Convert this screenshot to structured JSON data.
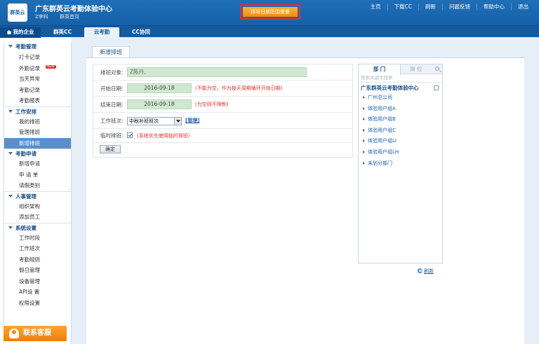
{
  "header": {
    "logo_text": "群英云",
    "title": "广东群英云考勤体验中心",
    "sub_user": "Z李科",
    "sub_link": "群英首页",
    "notice": "排班日期范围重叠",
    "topnav": [
      "主页",
      "下载CC",
      "刷新",
      "问题反馈",
      "帮助中心",
      "退出"
    ]
  },
  "tabs": {
    "my_company": "我的企业",
    "qunying_cc": "群英CC",
    "cloud_attendance": "云考勤",
    "cc_collab": "CC协同"
  },
  "sidebar": {
    "groups": [
      {
        "title": "考勤管理",
        "items": [
          "打卡记录",
          "外勤记录",
          "当天异常",
          "考勤记录",
          "考勤报表"
        ]
      },
      {
        "title": "工作安排",
        "items": [
          "我的排班",
          "管理排班",
          "新增排班"
        ]
      },
      {
        "title": "考勤申请",
        "items": [
          "新增申请",
          "申 请 单",
          "请假类别"
        ]
      },
      {
        "title": "人事管理",
        "items": [
          "组织架构",
          "添加员工"
        ]
      },
      {
        "title": "系统设置",
        "items": [
          "工作时段",
          "工作班次",
          "考勤规则",
          "假日管理",
          "设备管理",
          "API设 置",
          "权限设置"
        ]
      }
    ],
    "new_badge": "NEW",
    "service_button": "联系客服"
  },
  "page": {
    "tab_title": "新增排班",
    "form": {
      "target_label": "排班对象:",
      "target_value": "Z陈丹,",
      "start_label": "开始日期:",
      "start_value": "2016-09-18",
      "start_hint": "(不能为空，作为按天周期循环开始日期)",
      "end_label": "结束日期:",
      "end_value": "2016-09-18",
      "end_hint": "(为空则不限制)",
      "shift_label": "工作班次:",
      "shift_value": "中秋补班班次",
      "manage_link": "[管理]",
      "temp_label": "临时排班:",
      "temp_checked": true,
      "temp_hint": "(系统优先使用临时排班)",
      "confirm_button": "确定"
    },
    "dept_panel": {
      "tab_dept": "部 门",
      "tab_position": "岗 位",
      "search_placeholder": "搜索关键字搜索",
      "root": "广东群英云考勤体验中心",
      "items": [
        "广州总公司",
        "体验用户组A",
        "体验用户组B",
        "体验用户组C",
        "体验用户组LI",
        "体验用户组LH",
        "未划分部门"
      ]
    },
    "refresh_link": "刷新"
  }
}
